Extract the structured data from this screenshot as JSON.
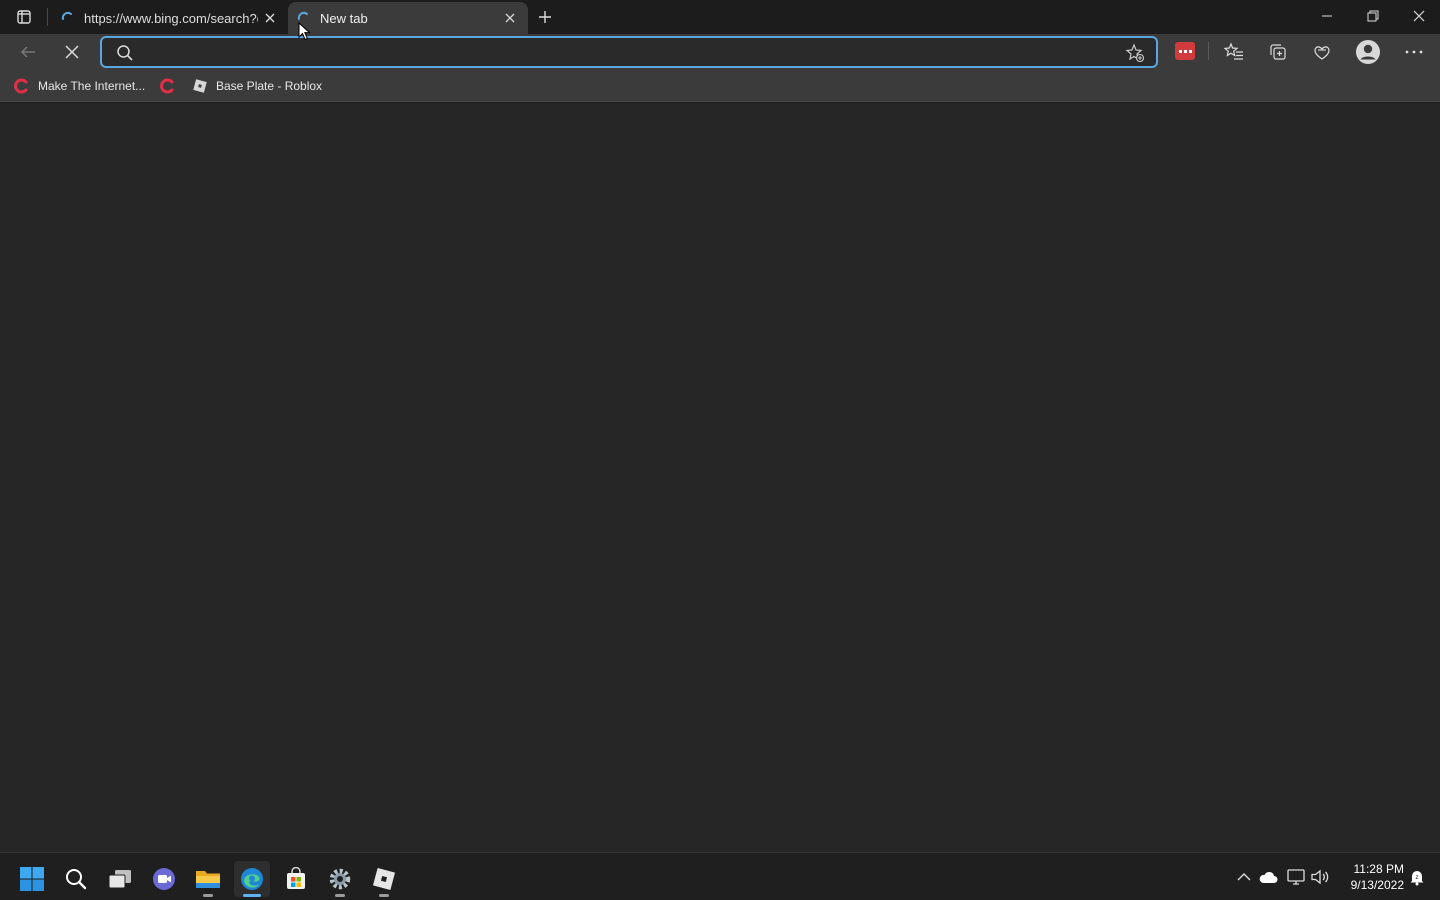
{
  "window": {
    "tabs": [
      {
        "title": "https://www.bing.com/search?q=",
        "active": false,
        "loading": true
      },
      {
        "title": "New tab",
        "active": true,
        "loading": true
      }
    ]
  },
  "toolbar": {
    "address": {
      "value": "",
      "placeholder": ""
    }
  },
  "favorites": [
    {
      "label": "Make The Internet...",
      "icon": "red-c-icon"
    },
    {
      "label": "",
      "icon": "red-c-icon"
    },
    {
      "label": "Base Plate - Roblox",
      "icon": "roblox-icon"
    }
  ],
  "taskbar": {
    "apps": [
      "start",
      "search",
      "task-view",
      "chat",
      "file-explorer",
      "edge",
      "store",
      "settings",
      "roblox"
    ],
    "clock": {
      "time": "11:28 PM",
      "date": "9/13/2022"
    }
  },
  "colors": {
    "accent": "#5aa7e0",
    "brand_red": "#d23b3b"
  }
}
